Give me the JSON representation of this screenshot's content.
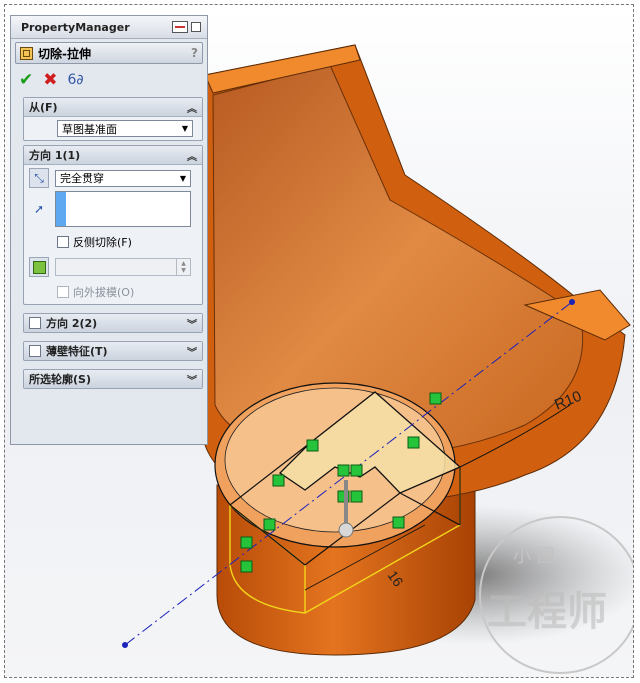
{
  "panel": {
    "title": "PropertyManager",
    "feature_name": "切除-拉伸",
    "help": "?",
    "actions": {
      "ok": "✔",
      "cancel": "✖",
      "preview": "6∂"
    }
  },
  "from_group": {
    "title": "从(F)",
    "value": "草图基准面"
  },
  "direction1": {
    "title": "方向 1(1)",
    "end_condition": "完全贯穿",
    "flip_side_label": "反侧切除(F)",
    "draft_outward_label": "向外拔模(O)"
  },
  "direction2": {
    "title": "方向 2(2)"
  },
  "thin_feature": {
    "title": "薄壁特征(T)"
  },
  "selected_contours": {
    "title": "所选轮廓(S)"
  },
  "viewport": {
    "dim_radius": "R10",
    "dim_width": "16",
    "watermark_top": "小  國",
    "watermark_main": "工程师",
    "model_color": "#e0701c"
  }
}
